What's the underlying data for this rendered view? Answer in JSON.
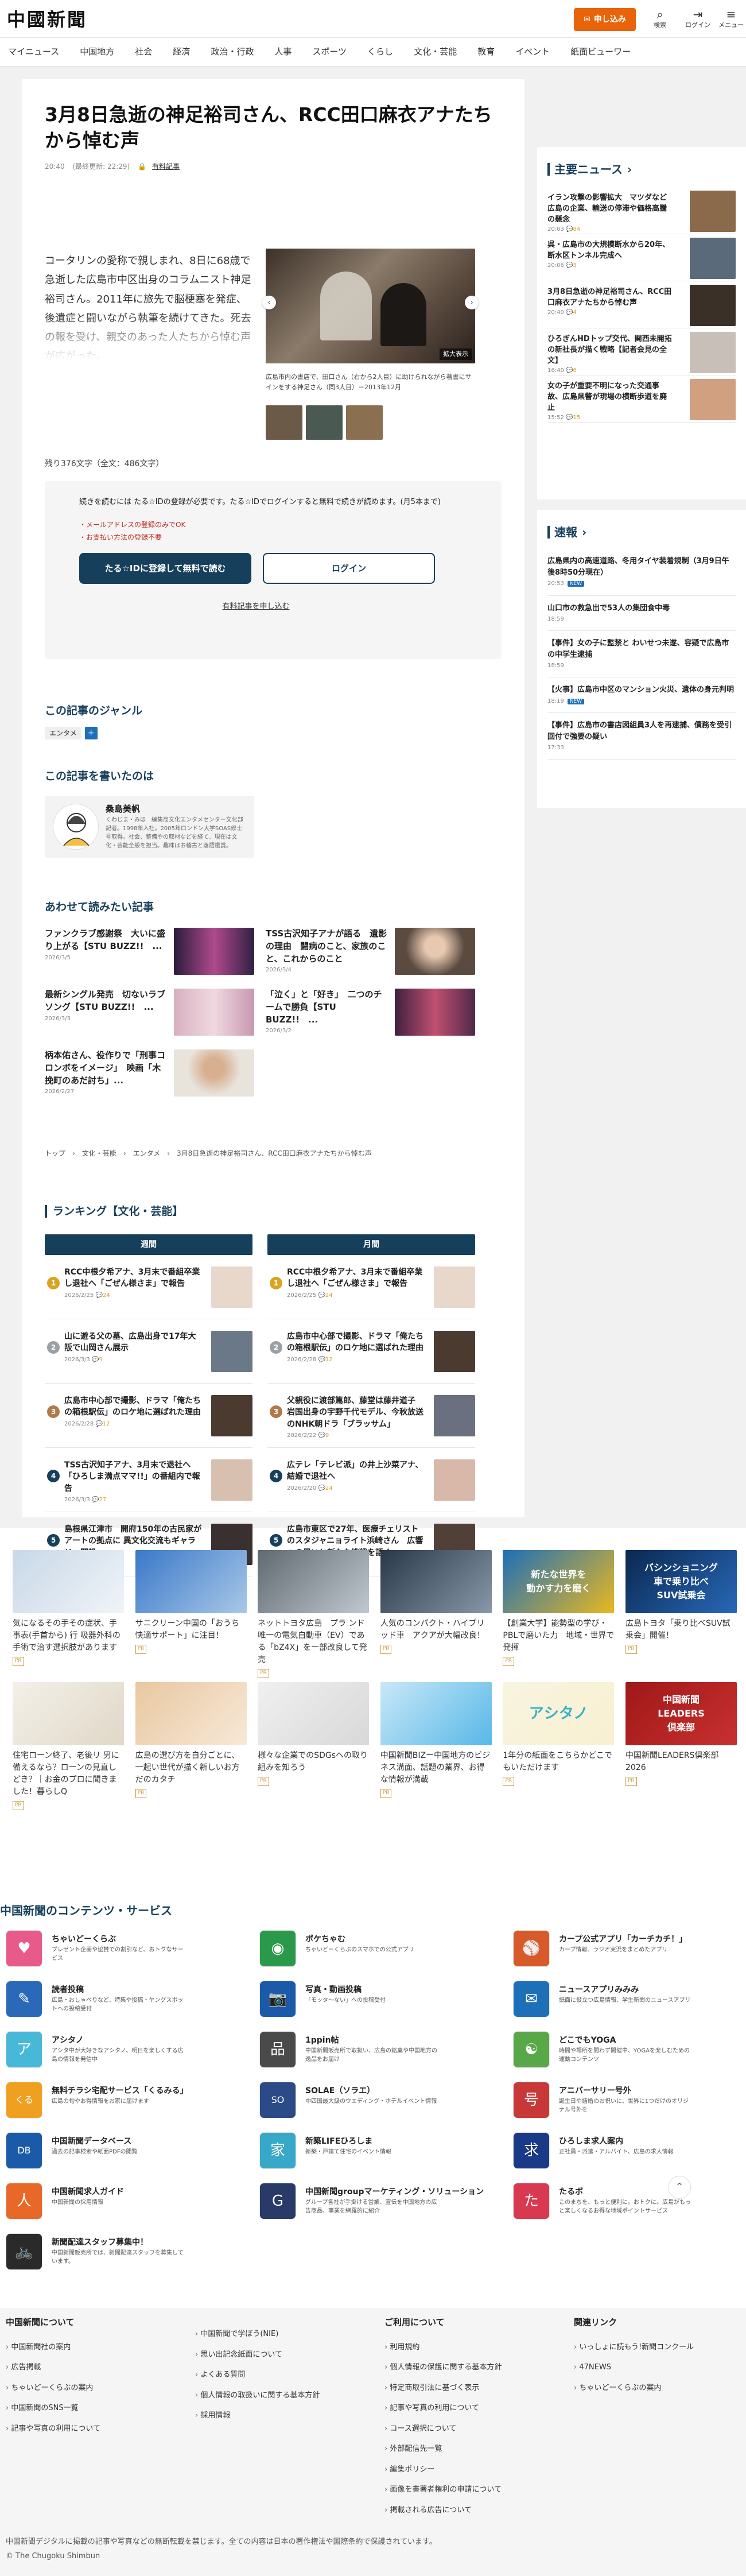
{
  "header": {
    "logo": "中國新聞",
    "subscribe": "申し込み",
    "search": "検索",
    "login": "ログイン",
    "menu": "メニュー"
  },
  "nav": [
    "マイニュース",
    "中国地方",
    "社会",
    "経済",
    "政治・行政",
    "人事",
    "スポーツ",
    "くらし",
    "文化・芸能",
    "教育",
    "イベント",
    "紙面ビューワー"
  ],
  "article": {
    "title": "3月8日急逝の神足裕司さん、RCC田口麻衣アナたちから悼む声",
    "date": "20:40",
    "updated": "(最終更新: 22:29)",
    "clip": "有料記事",
    "lead": "コータリンの愛称で親しまれ、8日に68歳で急逝した広島市中区出身のコラムニスト神足裕司さん。2011年に旅先で脳梗塞を発症、後遺症と闘いながら執筆を続けてきた。死去の報を受け、親交のあった人たちから悼む声が広がった。",
    "photo_badge": "拡大表示",
    "caption": "広島市内の書店で、田口さん（右から2人目）に助けられながら著書にサインをする神足さん（同3人目）＝2013年12月",
    "count": "残り376文字（全文：486文字）",
    "reg_text": "続きを読むには たる☆IDの登録が必要です。たる☆IDでログインすると無料で続きが読めます。(月5本まで)",
    "reg_notes": [
      "・メールアドレスの登録のみでOK",
      "・お支払い方法の登録不要"
    ],
    "reg_btn": "たる☆IDに登録して無料で読む",
    "login_btn": "ログイン",
    "terms": "有料記事を申し込む"
  },
  "genre": {
    "heading": "この記事のジャンル",
    "tag": "エンタメ",
    "plus": "+"
  },
  "writer": {
    "heading": "この記事を書いたのは",
    "name": "桑島美帆",
    "desc": "くわじま・みほ　編集局文化エンタメセンター文化部記者。1998年入社。2005年ロンドン大学SOAS修士号取得。社会、整備やの取材などを経て、現在は文化・芸能全般を担当。趣味はお稽古と落語鑑賞。"
  },
  "related": {
    "heading": "あわせて読みたい記事",
    "items": [
      {
        "title": "ファンクラブ感謝祭　大いに盛り上がる【STU BUZZ!!　...",
        "date": "2026/3/5"
      },
      {
        "title": "TSS古沢知子アナが語る　遺影の理由　闘病のこと、家族のこと、これからのこと",
        "date": "2026/3/4"
      },
      {
        "title": "最新シングル発売　切ないラブソング【STU BUZZ!!　...",
        "date": "2026/3/3"
      },
      {
        "title": "「泣く」と「好き」　二つのチームで勝負【STU BUZZ!!　...",
        "date": "2026/3/2"
      },
      {
        "title": "柄本佑さん、役作りで「刑事コロンボをイメージ」　映画「木挽町のあだ討ち」...",
        "date": "2026/2/27"
      }
    ]
  },
  "breadcrumb": "トップ　›　文化・芸能　›　エンタメ　›　3月8日急逝の神足裕司さん、RCC田口麻衣アナたちから悼む声",
  "ranking": {
    "heading": "ランキング【文化・芸能】",
    "weekly": "週間",
    "monthly": "月間",
    "weekly_items": [
      {
        "n": "1",
        "t": "RCC中根夕希アナ、3月末で番組卒業し退社へ「ごぜん様さま」で報告",
        "d": "2026/2/25",
        "c": "24"
      },
      {
        "n": "2",
        "t": "山に遊る父の墓、広島出身で17年大阪で山岡さん展示",
        "d": "2026/3/3",
        "c": "9"
      },
      {
        "n": "3",
        "t": "広島市中心部で撮影、ドラマ「俺たちの箱根駅伝」のロケ地に選ばれた理由",
        "d": "2026/2/28",
        "c": "12"
      },
      {
        "n": "4",
        "t": "TSS古沢知子アナ、3月末で退社へ「ひろしま満点ママ!!」の番組内で報告",
        "d": "2026/3/3",
        "c": "27"
      },
      {
        "n": "5",
        "t": "島根県江津市　開府150年の古民家がアートの拠点に 異文化交流もギャラリー開設",
        "d": "2026/3/4",
        "c": "7"
      }
    ],
    "monthly_items": [
      {
        "n": "1",
        "t": "RCC中根夕希アナ、3月末で番組卒業し退社へ「ごぜん様さま」で報告",
        "d": "2026/2/25",
        "c": "24"
      },
      {
        "n": "2",
        "t": "広島市中心部で撮影、ドラマ「俺たちの箱根駅伝」のロケ地に選ばれた理由",
        "d": "2026/2/28",
        "c": "12"
      },
      {
        "n": "3",
        "t": "父親役に渡部篤郎、藤堂は藤井道子 岩国出身の宇野千代モデル、今秋放送のNHK朝ドラ「ブラッサム」",
        "d": "2026/2/22",
        "c": "9"
      },
      {
        "n": "4",
        "t": "広テレ「テレビ派」の井上沙菜アナ、結婚で退社へ",
        "d": "2026/2/20",
        "c": "24"
      },
      {
        "n": "5",
        "t": "広島市東区で27年、医療チェリストのスタジャニョライト浜崎さん　広響への思いと新たな挑戦を語く",
        "d": "2026/2/23",
        "c": "13"
      }
    ]
  },
  "sidebar": {
    "main_heading": "主要ニュース",
    "main": [
      {
        "t": "イラン攻撃の影響拡大　マツダなど広島の企業、輸送の停滞や価格高騰の懸念",
        "d": "20:03",
        "c": "84"
      },
      {
        "t": "呉・広島市の大規模断水から20年、断水区トンネル完成へ",
        "d": "20:06",
        "c": "3"
      },
      {
        "t": "3月8日急逝の神足裕司さん、RCC田口麻衣アナたちから悼む声",
        "d": "20:40",
        "c": "4"
      },
      {
        "t": "ひろぎんHDトップ交代、関西未開拓の新社長が描く戦略【記者会見の全文】",
        "d": "16:40",
        "c": "6"
      },
      {
        "t": "女の子が重要不明になった交通事故、広島県警が現場の横断歩道を廃止",
        "d": "15:52",
        "c": "15"
      }
    ],
    "flash_heading": "速報",
    "flash": [
      {
        "t": "広島県内の高速道路、冬用タイヤ装着規制（3月9日午後8時50分現在）",
        "d": "20:53",
        "new": "NEW"
      },
      {
        "t": "山口市の救急出で53人の集団食中毒",
        "d": "18:59"
      },
      {
        "t": "【事件】女の子に監禁と わいせつ未遂、容疑で広島市の中学生逮捕",
        "d": "18:59"
      },
      {
        "t": "【火事】広島市中区のマンション火災、遺体の身元判明",
        "d": "18:19",
        "new": "NEW"
      },
      {
        "t": "【事件】広島市の書店図組員3人を再逮捕、債務を受引回付で強要の疑い",
        "d": "17:33"
      }
    ]
  },
  "ads": [
    {
      "t": "気になるその手その症状、手事表(手首から)  行 吸器外科の手術で治す選択肢があります",
      "p": "PR"
    },
    {
      "t": "サニクリーン中国の「おうち快適サポート」に注目！",
      "p": "PR"
    },
    {
      "t": "ネットトヨタ広島　プラ ンド唯一の電気自動車（EV）である「bZ4X」をー部改良して発売",
      "p": "PR"
    },
    {
      "t": "人気のコンパクト・ハイブリッド車　アクアが大幅改良！",
      "p": "PR"
    },
    {
      "t": "【創業大学】能勢型の学び・PBLで磨いた力　地域・世界で発揮",
      "p": "PR"
    },
    {
      "t": "広島トヨタ「乗り比べSUV試乗会」開催！",
      "p": "PR"
    },
    {
      "t": "住宅ローン終了、老後リ 男に備えるなら？ローンの見直しどき？｜お金のプロに聞きました！暮らしQ",
      "p": "PR"
    },
    {
      "t": "広島の選び方を自分ごとに、一起い世代が描く新しいお方だのカタチ",
      "p": "PR"
    },
    {
      "t": "様々な企業でのSDGsへの取り組みを知ろう",
      "p": "PR"
    },
    {
      "t": "中国新聞BIZー中国地方のビジネス溝面、話題の業界、お得な情報が満載",
      "p": "PR"
    },
    {
      "t": "1年分の紙面をこちらかどこでもいただけます",
      "p": "PR"
    },
    {
      "t": "中国新聞LEADERS倶楽部2026",
      "p": "PR"
    }
  ],
  "ad_banner_texts": {
    "a5a": "新たな世界を",
    "a5b": "動かす力を磨く",
    "a6a": "バシンショニング",
    "a6b": "車で乗り比べ",
    "a6c": "SUV試乗会",
    "a11": "アシタノ",
    "a12a": "中国新聞",
    "a12b": "LEADERS",
    "a12c": "倶楽部"
  },
  "services": {
    "heading": "中国新聞のコンテンツ・サービス",
    "items": [
      {
        "n": "ちゃいどーくらぶ",
        "d": "プレゼント企画や協賛での割引など、おトクなサービス"
      },
      {
        "n": "ポケちゃむ",
        "d": "ちゃいどーくらぶのスマホでの公式アプリ"
      },
      {
        "n": "カープ公式アプリ「カーチカチ！」",
        "d": "カープ情報、ラジオ実況をまとめたアプリ"
      },
      {
        "n": "読者投稿",
        "d": "広島・おしゃべりなど、特集や投稿・ヤングスポットへの投稿受付"
      },
      {
        "n": "写真・動画投稿",
        "d": "「モッタ～ない」への投稿受付"
      },
      {
        "n": "ニュースアプリみみみ",
        "d": "紙面に役立つ広島情報、学生新聞のニュースアプリ"
      },
      {
        "n": "アシタノ",
        "d": "アシタ中が大好きなアシタノ、明日を楽しくする広島の情報を発信中"
      },
      {
        "n": "1ppin帖",
        "d": "中国新聞販売所で取扱い、広島の銘菓や中国地方の逸品をお届け"
      },
      {
        "n": "どこでもYOGA",
        "d": "時間や場所を問わず開催中、YOGAを楽しむための運動コンテンツ"
      },
      {
        "n": "無料チラシ宅配サービス「くるみる」",
        "d": "広島の旬やお得情報をお家に届けます"
      },
      {
        "n": "SOLAE（ソラエ）",
        "d": "中四国最大級のウエディング・ホテルイベント情報"
      },
      {
        "n": "アニバーサリー号外",
        "d": "誕生日や結婚のお祝いに、世界に1つだけのオリジナル号外を"
      },
      {
        "n": "中国新聞データベース",
        "d": "過去の記事検索や紙面PDFの閲覧"
      },
      {
        "n": "新築LIFEひろしま",
        "d": "新築・戸建て住宅のイベント情報"
      },
      {
        "n": "ひろしま求人案内",
        "d": "正社員・派遣・アルバイト、広島の求人情報"
      },
      {
        "n": "中国新聞求人ガイド",
        "d": "中国新聞の採用情報"
      },
      {
        "n": "中国新聞groupマーケティング・ソリューション",
        "d": "グループ各社が手掛ける営業、宣伝を中国地方の広告商品、事業を網羅的に紹介"
      },
      {
        "n": "たるボ",
        "d": "このまちを、もっと便利に。おトクに。広島がもっと楽しくなるお得な地域ポイントサービス"
      },
      {
        "n": "新聞配達スタッフ募集中！",
        "d": "中国新聞販売所では、新聞配達スタッフを募集しています。"
      }
    ]
  },
  "footer": {
    "cols": [
      {
        "h": "中国新聞について",
        "items": [
          "中国新聞社の案内",
          "広告掲載",
          "ちゃいどーくらぶの案内",
          "中国新聞のSNS一覧",
          "記事や写真の利用について"
        ]
      },
      {
        "h": "",
        "items": [
          "中国新聞で学ぼう(NIE)",
          "思い出記念紙面について",
          "よくある質問",
          "個人情報の取扱いに関する基本方針",
          "採用情報"
        ]
      },
      {
        "h": "ご利用について",
        "items": [
          "利用規約",
          "個人情報の保護に関する基本方針",
          "特定商取引法に基づく表示",
          "記事や写真の利用について",
          "コース選択について",
          "外部配信先一覧",
          "編集ポリシー",
          "画像を書著者権利の申請について",
          "掲載される広告について"
        ]
      },
      {
        "h": "関連リンク",
        "items": [
          "いっしょに読もう!新聞コンクール",
          "47NEWS",
          "ちゃいどーくらぶの案内"
        ]
      }
    ],
    "copy1": "中国新聞デジタルに掲載の記事や写真などの無断転載を禁じます。全ての内容は日本の著作権法や国際条約で保護されています。",
    "copy2": "© The Chugoku Shimbun"
  },
  "colors": {
    "accent": "#163f5b",
    "orange": "#e8630a",
    "link": "#1d6fb8"
  },
  "icons": [
    "search-icon",
    "login-icon",
    "menu-icon",
    "chevron-left-icon",
    "chevron-right-icon",
    "arrow-up-icon",
    "comment-icon"
  ]
}
